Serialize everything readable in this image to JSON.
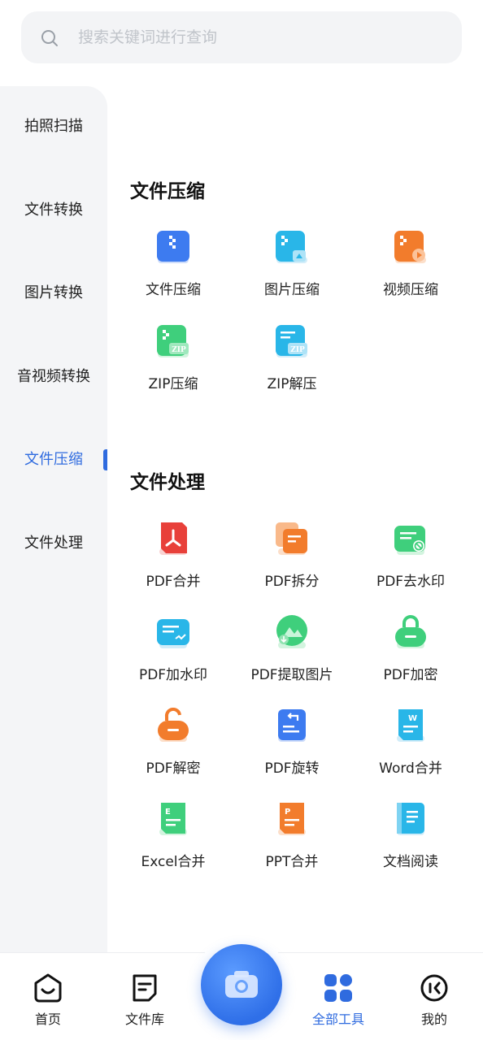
{
  "search": {
    "placeholder": "搜索关键词进行查询"
  },
  "sidebar": {
    "items": [
      {
        "label": "拍照扫描"
      },
      {
        "label": "文件转换"
      },
      {
        "label": "图片转换"
      },
      {
        "label": "音视频转换"
      },
      {
        "label": "文件压缩"
      },
      {
        "label": "文件处理"
      }
    ],
    "active": "文件压缩"
  },
  "sections": [
    {
      "title": "文件压缩",
      "tools": [
        {
          "label": "文件压缩",
          "icon": "file-compress-icon"
        },
        {
          "label": "图片压缩",
          "icon": "image-compress-icon"
        },
        {
          "label": "视频压缩",
          "icon": "video-compress-icon"
        },
        {
          "label": "ZIP压缩",
          "icon": "zip-compress-icon"
        },
        {
          "label": "ZIP解压",
          "icon": "zip-extract-icon"
        }
      ]
    },
    {
      "title": "文件处理",
      "tools": [
        {
          "label": "PDF合并",
          "icon": "pdf-merge-icon"
        },
        {
          "label": "PDF拆分",
          "icon": "pdf-split-icon"
        },
        {
          "label": "PDF去水印",
          "icon": "pdf-remove-watermark-icon"
        },
        {
          "label": "PDF加水印",
          "icon": "pdf-add-watermark-icon"
        },
        {
          "label": "PDF提取图片",
          "icon": "pdf-extract-image-icon"
        },
        {
          "label": "PDF加密",
          "icon": "pdf-encrypt-icon"
        },
        {
          "label": "PDF解密",
          "icon": "pdf-decrypt-icon"
        },
        {
          "label": "PDF旋转",
          "icon": "pdf-rotate-icon"
        },
        {
          "label": "Word合并",
          "icon": "word-merge-icon"
        },
        {
          "label": "Excel合并",
          "icon": "excel-merge-icon"
        },
        {
          "label": "PPT合并",
          "icon": "ppt-merge-icon"
        },
        {
          "label": "文档阅读",
          "icon": "doc-read-icon"
        }
      ]
    }
  ],
  "bottom_nav": {
    "items": [
      {
        "label": "首页",
        "icon": "home-icon"
      },
      {
        "label": "文件库",
        "icon": "file-library-icon"
      },
      {
        "label": "全部工具",
        "icon": "all-tools-icon"
      },
      {
        "label": "我的",
        "icon": "profile-icon"
      }
    ],
    "active": "全部工具",
    "center_icon": "camera-icon"
  },
  "colors": {
    "accent": "#2f6bdf",
    "blue": "#3d7bf0",
    "cyan": "#29b6e8",
    "orange": "#f27c2c",
    "green": "#3fcf7c",
    "red": "#e8403a"
  }
}
